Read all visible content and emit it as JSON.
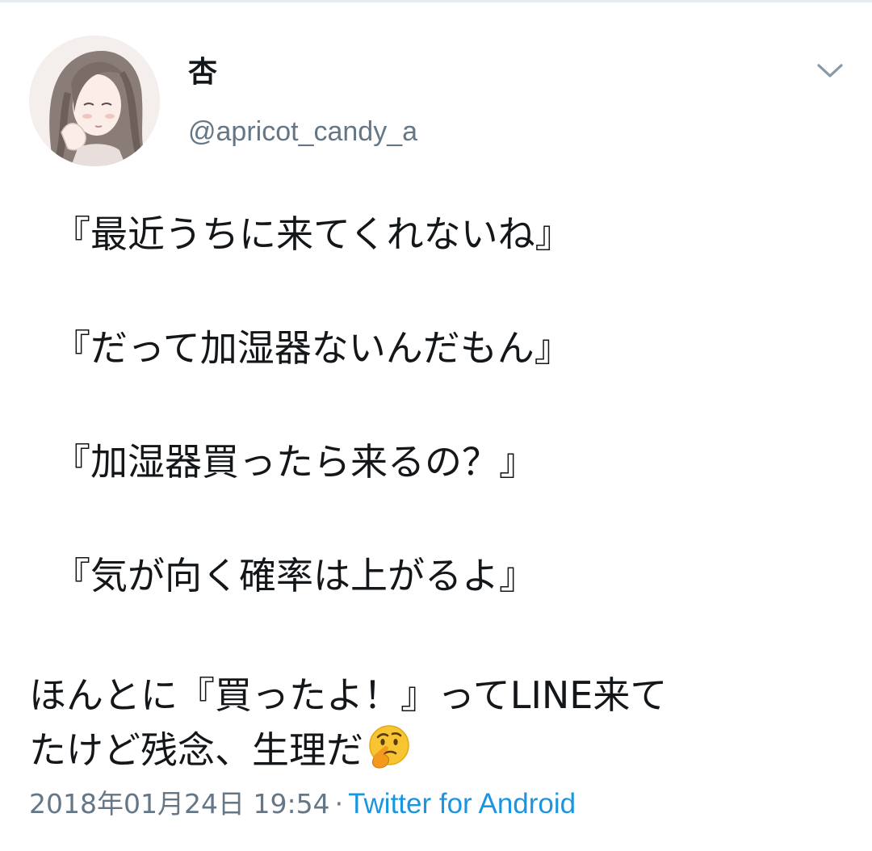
{
  "tweet": {
    "author": {
      "display_name": "杏",
      "handle": "@apricot_candy_a",
      "avatar_icon": "profile-avatar-illustration"
    },
    "menu_icon": "chevron-down-icon",
    "dialogue": [
      "『最近うちに来てくれないね』",
      "『だって加湿器ないんだもん』",
      "『加湿器買ったら来るの？』",
      "『気が向く確率は上がるよ』"
    ],
    "body_lines": [
      "ほんとに『買ったよ！』ってLINE来て",
      "たけど残念、生理だ"
    ],
    "emoji": "thinking-face-icon",
    "timestamp": "2018年01月24日 19:54",
    "separator": "·",
    "source": "Twitter for Android"
  },
  "colors": {
    "text": "#14171a",
    "secondary": "#657786",
    "link": "#1b95e0",
    "caret": "#8899a6"
  }
}
